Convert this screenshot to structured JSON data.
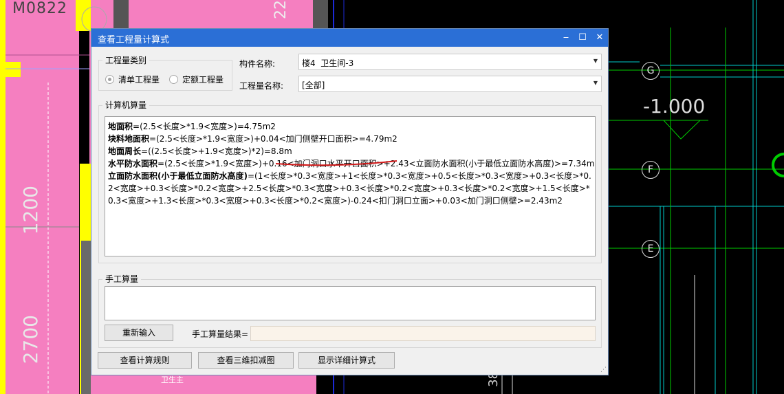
{
  "cad": {
    "door_label": "M0822",
    "dim_top": "22",
    "dim_1200": "1200",
    "dim_2700": "2700",
    "dim_bottom_right": "38",
    "elevation": "-1.000",
    "grid_g": "G",
    "grid_f": "F",
    "grid_e": "E",
    "bottom_text": "卫生主",
    "colors": {
      "pink": "#f57fc0",
      "yellow": "#ffff00",
      "green": "#00cc00",
      "cyan": "#00cccc",
      "blue": "#1c2ad8"
    }
  },
  "dialog": {
    "title": "查看工程量计算式",
    "window_buttons": {
      "minimize": "‒",
      "maximize": "☐",
      "close": "✕"
    },
    "type_group": {
      "label": "工程量类别",
      "options": [
        {
          "label": "清单工程量",
          "checked": true
        },
        {
          "label": "定额工程量",
          "checked": false
        }
      ]
    },
    "component": {
      "label": "构件名称:",
      "value": "楼4  卫生间-3"
    },
    "qty_name": {
      "label": "工程量名称:",
      "value": "[全部]"
    },
    "computer_calc": {
      "label": "计算机算量",
      "lines": [
        {
          "name": "地面积",
          "expr": "=(2.5<长度>*1.9<宽度>)=4.75m2"
        },
        {
          "name": "块料地面积",
          "expr": "=(2.5<长度>*1.9<宽度>)+0.04<加门侧壁开口面积>=4.79m2"
        },
        {
          "name": "地面周长",
          "expr": "=((2.5<长度>+1.9<宽度>)*2)=8.8m"
        },
        {
          "name": "水平防水面积",
          "expr": "=(2.5<长度>*1.9<宽度>)+0.16<加门洞口水平开口面积>+2.43<立面防水面积(小于最低立面防水高度)>=7.34m2"
        },
        {
          "name": "立面防水面积(小于最低立面防水高度)",
          "expr": "=(1<长度>*0.3<宽度>+1<长度>*0.3<宽度>+0.5<长度>*0.3<宽度>+0.3<长度>*0.2<宽度>+0.3<长度>*0.2<宽度>+2.5<长度>*0.3<宽度>+0.3<长度>*0.2<宽度>+0.3<长度>*0.2<宽度>+1.5<长度>*0.3<宽度>+1.3<长度>*0.3<宽度>+0.3<长度>*0.2<宽度>)-0.24<扣门洞口立面>+0.03<加门洞口侧壁>=2.43m2"
        }
      ]
    },
    "manual_calc": {
      "label": "手工算量",
      "reenter_button": "重新输入",
      "result_label": "手工算量结果=",
      "result_value": ""
    },
    "bottom_buttons": {
      "rules": "查看计算规则",
      "view3d": "查看三维扣减图",
      "detail": "显示详细计算式"
    }
  }
}
